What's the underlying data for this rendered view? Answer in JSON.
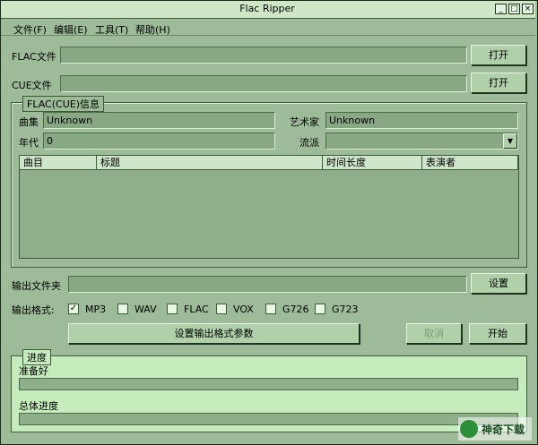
{
  "window": {
    "title": "Flac Ripper"
  },
  "title_buttons": {
    "minimize": "_",
    "maximize": "□",
    "close": "×"
  },
  "menu": [
    "文件(F)",
    "编辑(E)",
    "工具(T)",
    "帮助(H)"
  ],
  "flac_file": {
    "label": "FLAC文件",
    "value": "",
    "button": "打开"
  },
  "cue_file": {
    "label": "CUE文件",
    "value": "",
    "button": "打开"
  },
  "info_group": {
    "title": "FLAC(CUE)信息",
    "album_label": "曲集",
    "album_value": "Unknown",
    "artist_label": "艺术家",
    "artist_value": "Unknown",
    "year_label": "年代",
    "year_value": "0",
    "genre_label": "流派",
    "genre_value": "",
    "columns": [
      "曲目",
      "标题",
      "时间长度",
      "表演者"
    ]
  },
  "output_folder": {
    "label": "输出文件夹",
    "value": "",
    "button": "设置"
  },
  "output_format": {
    "label": "输出格式:",
    "options": [
      {
        "name": "MP3",
        "checked": true
      },
      {
        "name": "WAV",
        "checked": false
      },
      {
        "name": "FLAC",
        "checked": false
      },
      {
        "name": "VOX",
        "checked": false
      },
      {
        "name": "G726",
        "checked": false
      },
      {
        "name": "G723",
        "checked": false
      }
    ],
    "check_mark": "✓"
  },
  "actions": {
    "format_params": "设置输出格式参数",
    "cancel": "取消",
    "start": "开始"
  },
  "progress_group": {
    "title": "进度",
    "status": "准备好",
    "overall_label": "总体进度",
    "status_progress": 0,
    "overall_progress": 0
  },
  "watermark": {
    "text": "神奇下载"
  }
}
